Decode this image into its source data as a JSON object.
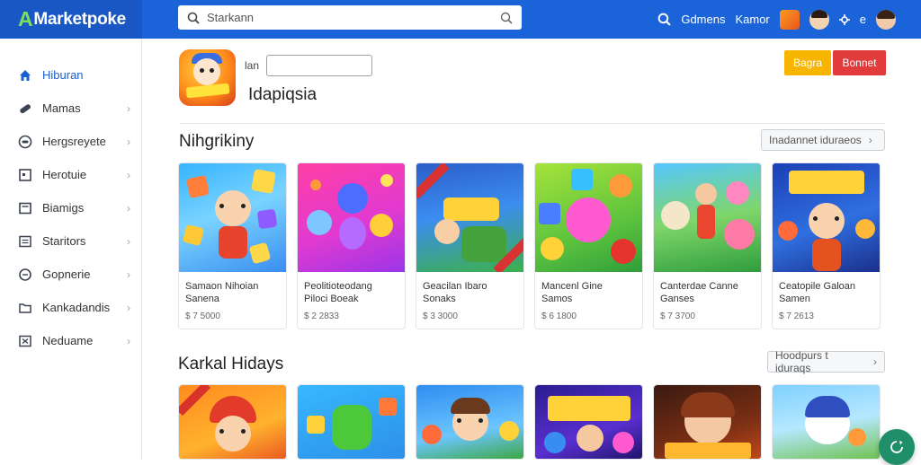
{
  "app": {
    "brand_letter": "A",
    "brand_rest": "Marketpoke"
  },
  "search": {
    "value": "Starkann"
  },
  "topbar": {
    "link1": "Gdmens",
    "link2": "Kamor",
    "link3": "e"
  },
  "sidebar": {
    "items": [
      {
        "label": "Hiburan",
        "icon": "home-icon",
        "active": true
      },
      {
        "label": "Mamas",
        "icon": "pill-icon"
      },
      {
        "label": "Hergsreyete",
        "icon": "gamepad-icon"
      },
      {
        "label": "Herotuie",
        "icon": "square-icon"
      },
      {
        "label": "Biamigs",
        "icon": "inbox-icon"
      },
      {
        "label": "Staritors",
        "icon": "grid-icon"
      },
      {
        "label": "Gopnerie",
        "icon": "circle-icon"
      },
      {
        "label": "Kankadandis",
        "icon": "folder-icon"
      },
      {
        "label": "Neduame",
        "icon": "crossed-square-icon"
      }
    ]
  },
  "header": {
    "lan_label": "lan",
    "app_title": "Idapiqsia",
    "btn_yellow": "Bagra",
    "btn_red": "Bonnet"
  },
  "section1": {
    "title": "Nihgrikiny",
    "see_more": "Inadannet iduraeos",
    "cards": [
      {
        "name": "Samaon Nihoian\nSanena",
        "price": "$ 7 5000"
      },
      {
        "name": "Peolitioteodang\nPiloci Boeak",
        "price": "$ 2 2833"
      },
      {
        "name": "Geacilan Ibaro\nSonaks",
        "price": "$ 3 3000"
      },
      {
        "name": "Mancenl Gine\nSamos",
        "price": "$ 6 1800"
      },
      {
        "name": "Canterdae Canne\nGanses",
        "price": "$ 7 3700"
      },
      {
        "name": "Ceatopile Galoan\nSamen",
        "price": "$ 7 2613"
      }
    ]
  },
  "section2": {
    "title": "Karkal Hidays",
    "see_more": "Hoodpurs t iduraqs"
  },
  "colors": {
    "topbar": "#1a63d8",
    "accent": "#1a5fd0",
    "yellow": "#f7b500",
    "red": "#e23b3b",
    "fab": "#1f8f6a"
  }
}
